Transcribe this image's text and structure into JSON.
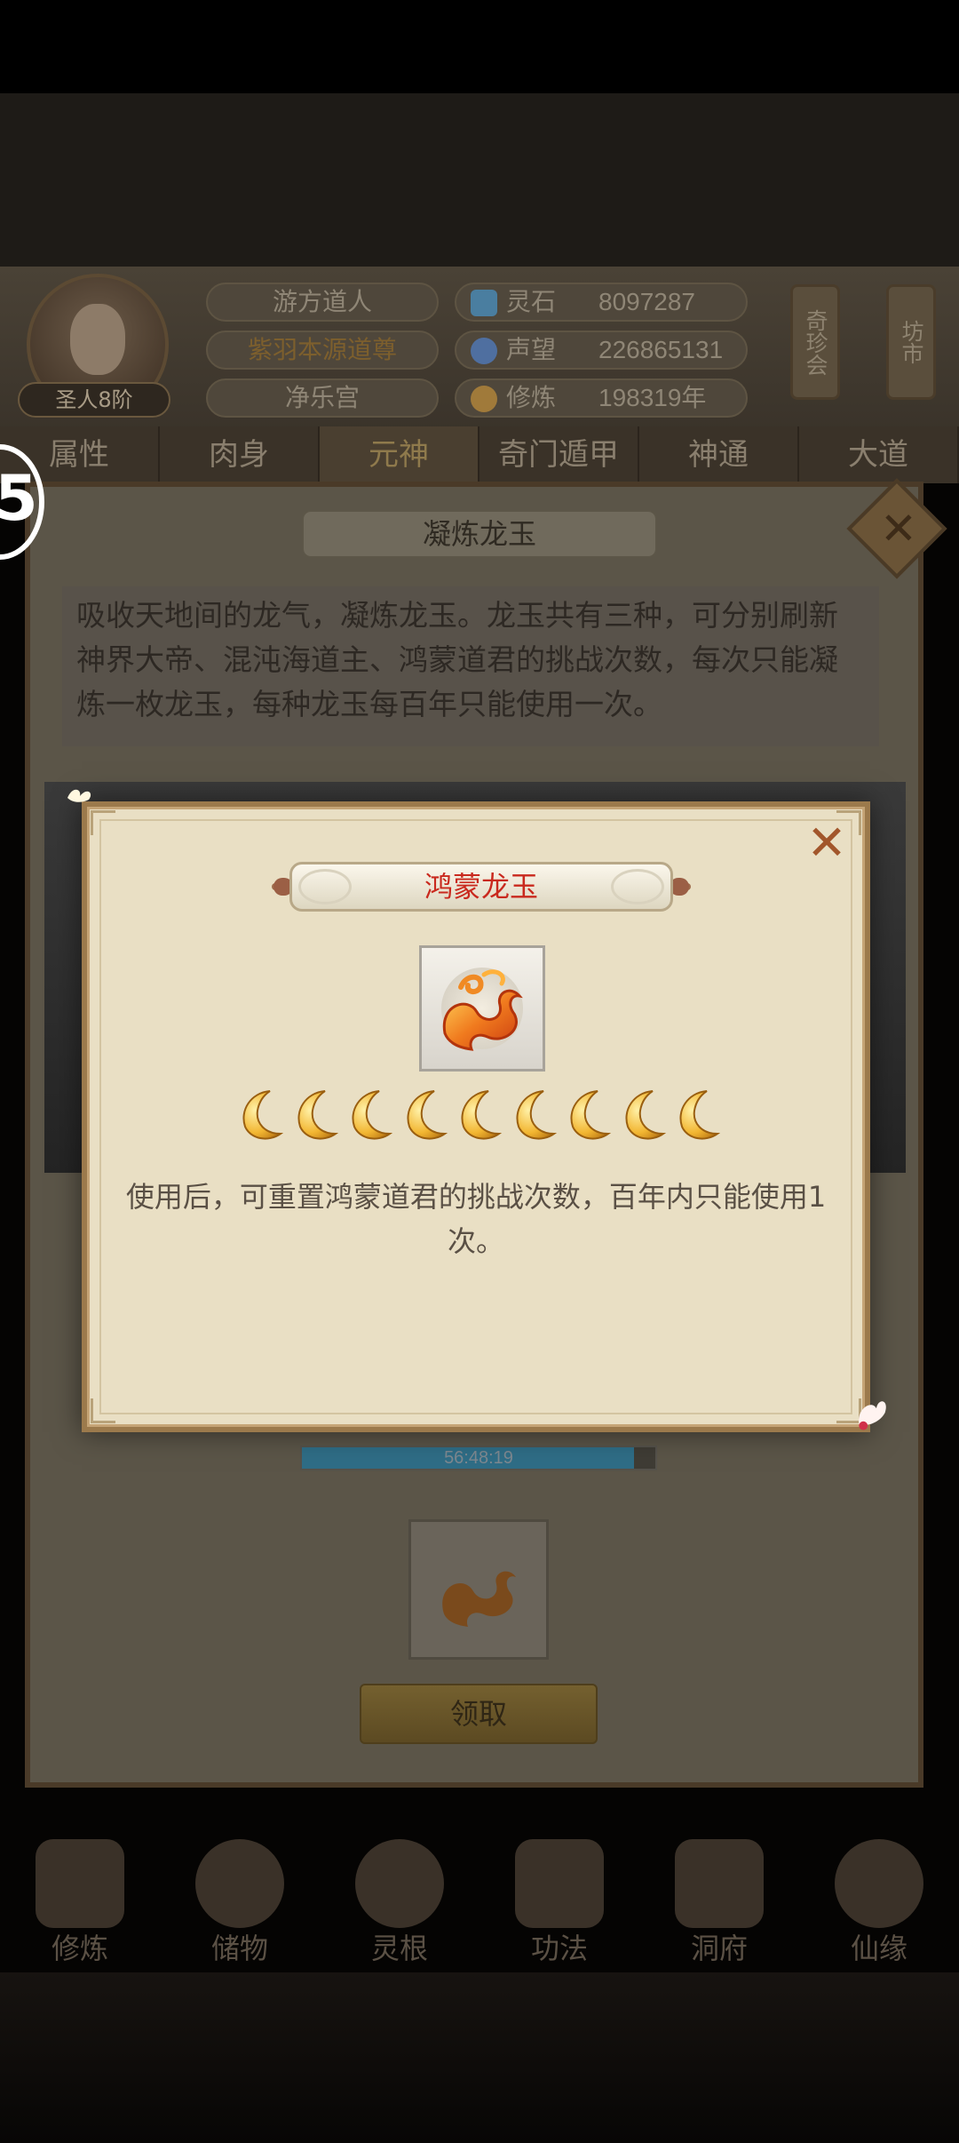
{
  "header": {
    "rank_badge": "圣人8阶",
    "identity": [
      "游方道人",
      "紫羽本源道尊",
      "净乐宫"
    ],
    "resources": [
      {
        "icon": "spirit-stone-icon",
        "label": "灵石",
        "value": "8097287",
        "color": "#4a7ea0"
      },
      {
        "icon": "prestige-icon",
        "label": "声望",
        "value": "226865131",
        "color": "#4f6fa0"
      },
      {
        "icon": "cultivation-icon",
        "label": "修炼",
        "value": "198319年",
        "color": "#a07a3a"
      }
    ],
    "side_buttons": [
      "奇珍会",
      "坊市"
    ]
  },
  "tabs": [
    "属性",
    "肉身",
    "元神",
    "奇门遁甲",
    "神通",
    "大道"
  ],
  "active_tab": "元神",
  "panel": {
    "title": "凝炼龙玉",
    "description": "吸收天地间的龙气，凝炼龙玉。龙玉共有三种，可分别刷新神界大帝、混沌海道主、鸿蒙道君的挑战次数，每次只能凝炼一枚龙玉，每种龙玉每百年只能使用一次。",
    "progress_time": "56:48:19",
    "progress_fraction": 0.94,
    "claim_label": "领取"
  },
  "modal": {
    "title": "鸿蒙龙玉",
    "close_icon": "close-icon",
    "item_icon": "dragon-jade-icon",
    "stars": 9,
    "star_icon": "crescent-moon-icon",
    "description": "使用后，可重置鸿蒙道君的挑战次数，百年内只能使用1次。"
  },
  "bottom_nav": [
    "修炼",
    "储物",
    "灵根",
    "功法",
    "洞府",
    "仙缘"
  ],
  "side_marker": "5",
  "colors": {
    "modal_bg": "#e9dfc4",
    "modal_border": "#9c7a4c",
    "title_red": "#c9291e",
    "close_orange": "#a2562b",
    "moon_gold": "#f2b632"
  }
}
